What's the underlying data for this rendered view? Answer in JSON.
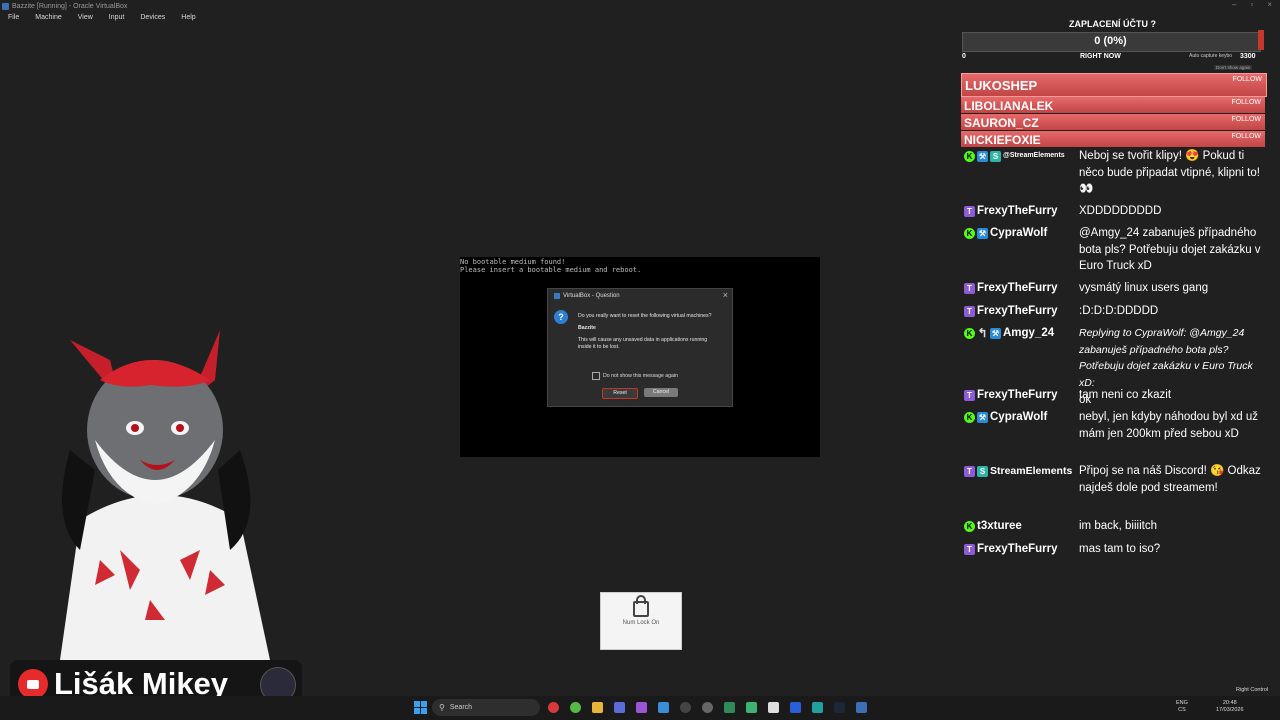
{
  "window": {
    "title": "Bazzite [Running] - Oracle VirtualBox",
    "menu": [
      "File",
      "Machine",
      "View",
      "Input",
      "Devices",
      "Help"
    ]
  },
  "vm": {
    "boot_message": "No bootable medium found!\nPlease insert a bootable medium and reboot."
  },
  "dialog": {
    "title": "VirtualBox - Question",
    "question": "Do you really want to reset the following virtual machines?",
    "vm_name": "Bazzite",
    "warning": "This will cause any unsaved data in applications running inside it to be lost.",
    "checkbox_label": "Do not show this message again",
    "reset_label": "Reset",
    "cancel_label": "Cancel"
  },
  "numlock": {
    "text": "Num Lock On"
  },
  "goal": {
    "title": "ZAPLACENÍ ÚČTU ?",
    "value": "0 (0%)",
    "min": "0",
    "mid": "RIGHT NOW",
    "max": "3300",
    "progress": 0,
    "auto_capture": "Auto capture keybo",
    "dont_show": "Don't show again"
  },
  "followers": [
    {
      "name": "LUKOSHEP",
      "action": "FOLLOW"
    },
    {
      "name": "LIBOLIANALEK",
      "action": "FOLLOW"
    },
    {
      "name": "SAURON_CZ",
      "action": "FOLLOW"
    },
    {
      "name": "NICKIEFOXIE",
      "action": "FOLLOW"
    }
  ],
  "chat": [
    {
      "platform": "kick",
      "user": "@StreamElements",
      "badges": [
        "mod",
        "se"
      ],
      "text": "Neboj se tvořit klipy! 😍 Pokud ti něco bude připadat vtipné, klipni to! 👀"
    },
    {
      "platform": "twitch",
      "user": "FrexyTheFurry",
      "badges": [],
      "text": "XDDDDDDDDD"
    },
    {
      "platform": "kick",
      "user": "CypraWolf",
      "badges": [
        "mod"
      ],
      "text": "@Amgy_24 zabanuješ případného bota pls? Potřebuju dojet zakázku v Euro Truck xD"
    },
    {
      "platform": "twitch",
      "user": "FrexyTheFurry",
      "badges": [],
      "text": "vysmátý linux users gang"
    },
    {
      "platform": "twitch",
      "user": "FrexyTheFurry",
      "badges": [],
      "text": ":D:D:D:DDDDD"
    },
    {
      "platform": "kick",
      "user": "Amgy_24",
      "badges": [
        "ret",
        "mod"
      ],
      "reply": "Replying to CypraWolf: @Amgy_24 zabanuješ případného bota pls? Potřebuju dojet zakázku v Euro Truck xD:",
      "text": "ok"
    },
    {
      "platform": "twitch",
      "user": "FrexyTheFurry",
      "badges": [],
      "text": "tam neni co zkazit"
    },
    {
      "platform": "kick",
      "user": "CypraWolf",
      "badges": [
        "mod"
      ],
      "text": "nebyl, jen kdyby náhodou byl xd už mám jen 200km před sebou xD"
    },
    {
      "platform": "twitch",
      "user": "StreamElements",
      "badges": [
        "se"
      ],
      "text": "Připoj se na náš Discord! 😘 Odkaz najdeš dole pod streamem!"
    },
    {
      "platform": "kick",
      "user": "t3xturee",
      "badges": [],
      "text": "im back, biiiitch"
    },
    {
      "platform": "twitch",
      "user": "FrexyTheFurry",
      "badges": [],
      "text": "mas tam to iso?"
    }
  ],
  "streamer": {
    "channel": "Lišák Mikey"
  },
  "taskbar": {
    "search_placeholder": "Search",
    "lang": "ENG\nCS",
    "time": "20:48",
    "date": "17/03/2026",
    "right_control": "Right Control"
  },
  "colors": {
    "follower_bar": "#d95555",
    "twitch": "#8d5ad8",
    "kick": "#53fc18",
    "reset_border": "#c0392b"
  }
}
